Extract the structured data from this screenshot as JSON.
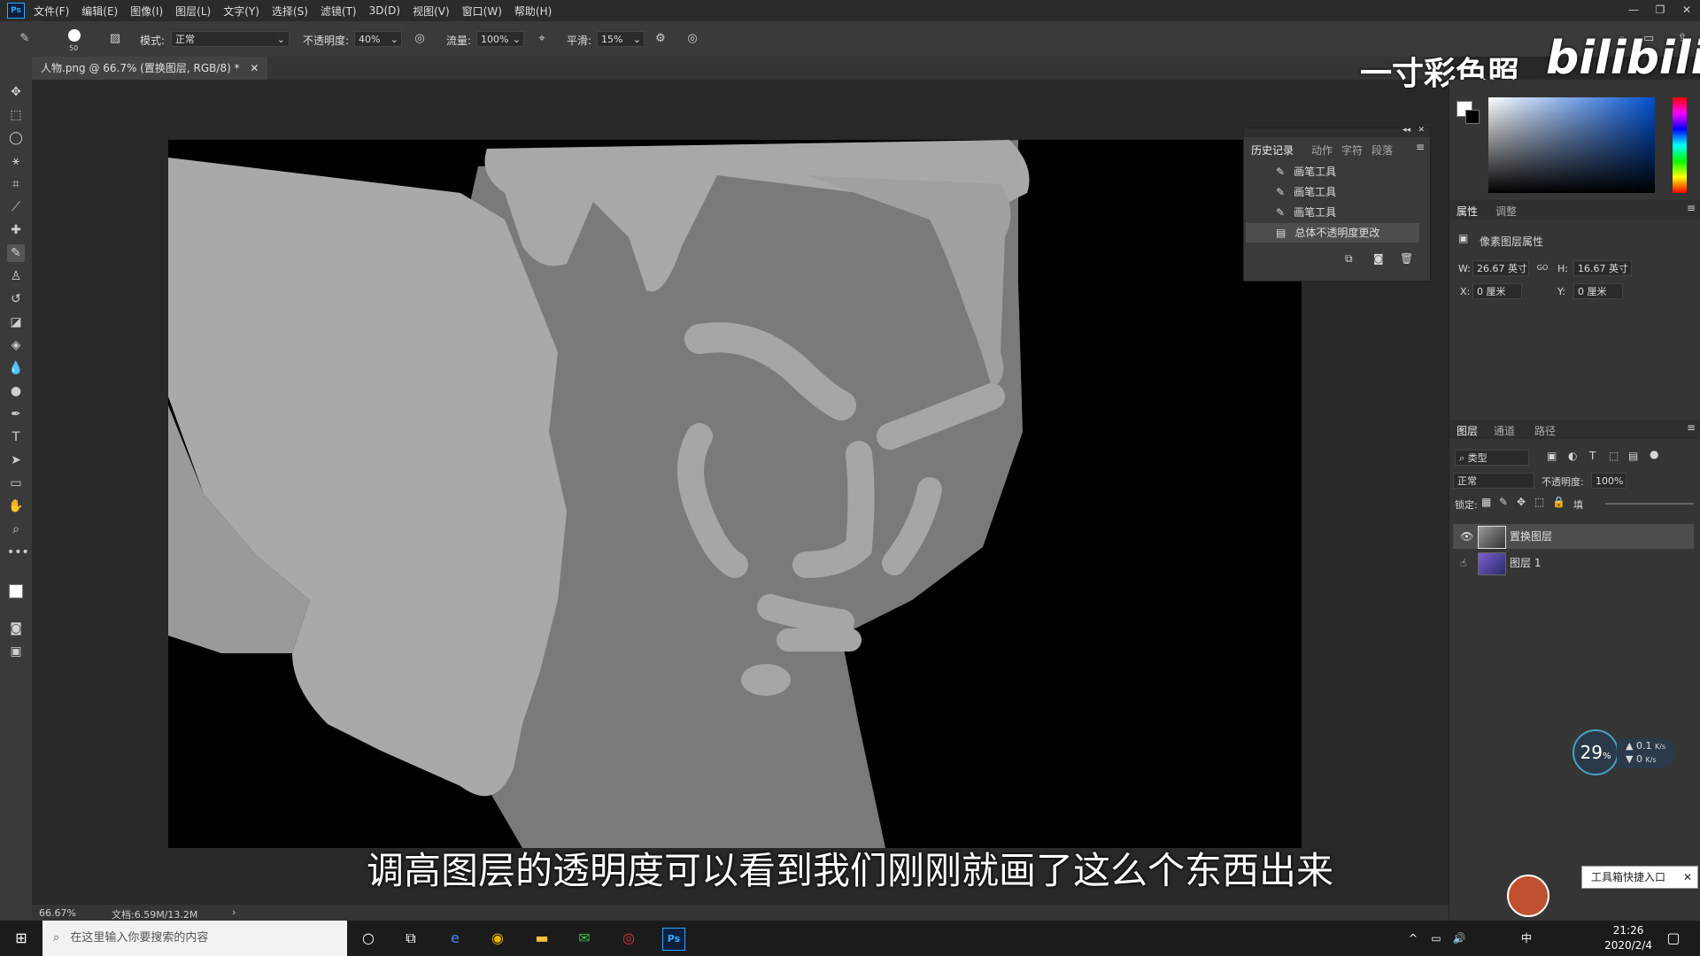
{
  "app": {
    "logo": "Ps"
  },
  "menu": [
    "文件(F)",
    "编辑(E)",
    "图像(I)",
    "图层(L)",
    "文字(Y)",
    "选择(S)",
    "滤镜(T)",
    "3D(D)",
    "视图(V)",
    "窗口(W)",
    "帮助(H)"
  ],
  "options": {
    "brush_size": "50",
    "mode_label": "模式:",
    "mode_value": "正常",
    "opacity_label": "不透明度:",
    "opacity_value": "40%",
    "flow_label": "流量:",
    "flow_value": "100%",
    "smooth_label": "平滑:",
    "smooth_value": "15%"
  },
  "document": {
    "tab_title": "人物.png @ 66.7% (置换图层, RGB/8) *",
    "zoom": "66.67%",
    "doc_info": "文档:6.59M/13.2M"
  },
  "subtitle": "调高图层的透明度可以看到我们刚刚就画了这么个东西出来",
  "watermark": {
    "text": "一寸彩色照",
    "logo": "bilibili"
  },
  "history_panel": {
    "tabs": [
      "历史记录",
      "动作",
      "字符",
      "段落"
    ],
    "items": [
      "画笔工具",
      "画笔工具",
      "画笔工具",
      "总体不透明度更改"
    ]
  },
  "properties_panel": {
    "tabs": [
      "属性",
      "调整"
    ],
    "header": "像素图层属性",
    "w_label": "W:",
    "w_value": "26.67 英寸",
    "h_label": "H:",
    "h_value": "16.67 英寸",
    "x_label": "X:",
    "x_value": "0 厘米",
    "y_label": "Y:",
    "y_value": "0 厘米",
    "link_icon": "GO"
  },
  "layers_panel": {
    "tabs": [
      "图层",
      "通道",
      "路径"
    ],
    "filter": "类型",
    "blend_mode": "正常",
    "opacity_label": "不透明度:",
    "opacity_value": "100%",
    "lock_label": "锁定:",
    "fill_label": "填",
    "layers": [
      "置换图层",
      "图层 1"
    ]
  },
  "taskbar": {
    "search_placeholder": "在这里输入你要搜索的内容",
    "time": "21:26",
    "date": "2020/2/4",
    "ime": "中"
  },
  "net_widget": {
    "percent": "29",
    "up": "0.1",
    "down": "0",
    "unit": "K/s"
  },
  "tool_popup": "工具箱快捷入口",
  "colors": {
    "accent": "#31a8ff",
    "canvas_bg": "#000000",
    "skin_light": "#a9a9a9",
    "skin_mid": "#7a7a7a"
  }
}
